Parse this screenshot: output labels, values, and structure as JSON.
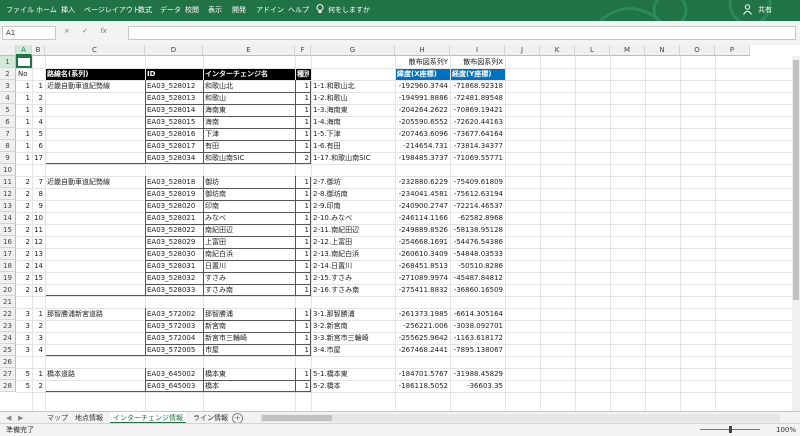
{
  "ribbon": {
    "tabs": [
      "ファイル",
      "ホーム",
      "挿入",
      "ページレイアウト",
      "数式",
      "データ",
      "校閲",
      "表示",
      "開発",
      "アドイン",
      "ヘルプ"
    ],
    "tell_me": "何をしますか",
    "share": "共有"
  },
  "formula_bar": {
    "name_box": "A1",
    "cancel": "×",
    "enter": "✓",
    "fx": "fx",
    "formula": ""
  },
  "columns": [
    "A",
    "B",
    "C",
    "D",
    "E",
    "F",
    "G",
    "H",
    "I",
    "J",
    "K",
    "L",
    "M",
    "N",
    "O",
    "P"
  ],
  "rows": [
    "1",
    "2",
    "3",
    "4",
    "5",
    "6",
    "7",
    "8",
    "9",
    "10",
    "11",
    "12",
    "13",
    "14",
    "15",
    "16",
    "17",
    "18",
    "19",
    "20",
    "21",
    "22",
    "23",
    "24",
    "25",
    "26",
    "27",
    "28"
  ],
  "table": {
    "series_y": "散布図系列Y",
    "series_x": "散布図系列X",
    "header": {
      "no": "No",
      "route": "路線名(系列)",
      "id": "ID",
      "ic": "インターチェンジ名",
      "kind": "種別",
      "lat": "緯度(X座標)",
      "lon": "経度(Y座標)"
    },
    "groups": [
      {
        "group_no": "1",
        "route": "近畿自動車道紀勢線",
        "rows": [
          [
            "1",
            "1",
            "EA03_528012",
            "和歌山北",
            "1",
            "1-1.和歌山北",
            "-192960.3744",
            "-71868.92318"
          ],
          [
            "1",
            "2",
            "EA03_528013",
            "和歌山",
            "1",
            "1-2.和歌山",
            "-194991.8886",
            "-72481.89548"
          ],
          [
            "1",
            "3",
            "EA03_528014",
            "海南東",
            "1",
            "1-3.海南東",
            "-204264.2622",
            "-70869.19421"
          ],
          [
            "1",
            "4",
            "EA03_528015",
            "海南",
            "1",
            "1-4.海南",
            "-205590.6552",
            "-72620.44163"
          ],
          [
            "1",
            "5",
            "EA03_528016",
            "下津",
            "1",
            "1-5.下津",
            "-207463.6096",
            "-73677.64164"
          ],
          [
            "1",
            "6",
            "EA03_528017",
            "有田",
            "1",
            "1-6.有田",
            "-214654.731",
            "-73814.34377"
          ],
          [
            "1",
            "17",
            "EA03_528034",
            "和歌山南SIC",
            "2",
            "1-17.和歌山南SIC",
            "-198485.3737",
            "-71069.55771"
          ]
        ]
      },
      {
        "group_no": "2",
        "route": "近畿自動車道紀勢線",
        "rows": [
          [
            "2",
            "7",
            "EA03_528018",
            "御坊",
            "1",
            "2-7.御坊",
            "-232880.6229",
            "-75409.61809"
          ],
          [
            "2",
            "8",
            "EA03_528019",
            "御坊南",
            "1",
            "2-8.御坊南",
            "-234041.4581",
            "-75612.63194"
          ],
          [
            "2",
            "9",
            "EA03_528020",
            "印南",
            "1",
            "2-9.印南",
            "-240900.2747",
            "-72214.46537"
          ],
          [
            "2",
            "10",
            "EA03_528021",
            "みなべ",
            "1",
            "2-10.みなべ",
            "-246114.1166",
            "-62582.8968"
          ],
          [
            "2",
            "11",
            "EA03_528022",
            "南紀田辺",
            "1",
            "2-11.南紀田辺",
            "-249889.8526",
            "-58138.95128"
          ],
          [
            "2",
            "12",
            "EA03_528029",
            "上富田",
            "1",
            "2-12.上富田",
            "-254668.1691",
            "-54476.54386"
          ],
          [
            "2",
            "13",
            "EA03_528030",
            "南紀白浜",
            "1",
            "2-13.南紀白浜",
            "-260610.3409",
            "-54848.03533"
          ],
          [
            "2",
            "14",
            "EA03_528031",
            "日置川",
            "1",
            "2-14.日置川",
            "-268451.8513",
            "-50510.8286"
          ],
          [
            "2",
            "15",
            "EA03_528032",
            "すさみ",
            "1",
            "2-15.すさみ",
            "-271089.9974",
            "-45487.84812"
          ],
          [
            "2",
            "16",
            "EA03_528033",
            "すさみ南",
            "1",
            "2-16.すさみ南",
            "-275411.8832",
            "-36860.16509"
          ]
        ]
      },
      {
        "group_no": "3",
        "route": "那智勝浦新宮道路",
        "rows": [
          [
            "3",
            "1",
            "EA03_572002",
            "那智勝浦",
            "1",
            "3-1.那智勝浦",
            "-261373.1985",
            "-6614.305164"
          ],
          [
            "3",
            "2",
            "EA03_572003",
            "新宮南",
            "1",
            "3-2.新宮南",
            "-256221.006",
            "-3038.092701"
          ],
          [
            "3",
            "3",
            "EA03_572004",
            "新宮市三輪崎",
            "1",
            "3-3.新宮市三輪崎",
            "-255625.9642",
            "-1163.618172"
          ],
          [
            "3",
            "4",
            "EA03_572005",
            "市屋",
            "1",
            "3-4.市屋",
            "-267468.2441",
            "-7895.138067"
          ]
        ]
      },
      {
        "group_no": "5",
        "route": "橋本道路",
        "rows": [
          [
            "5",
            "1",
            "EA03_645002",
            "橋本東",
            "1",
            "5-1.橋本東",
            "-184701.5767",
            "-31988.45829"
          ],
          [
            "5",
            "2",
            "EA03_645003",
            "橋本",
            "1",
            "5-2.橋本",
            "-186118.5052",
            "-36603.35"
          ]
        ]
      }
    ]
  },
  "sheet_tabs": [
    {
      "label": "マップ",
      "active": false
    },
    {
      "label": "地点情報",
      "active": false
    },
    {
      "label": "インターチェンジ情報",
      "active": true
    },
    {
      "label": "ライン情報",
      "active": false
    }
  ],
  "add_sheet": "+",
  "status": {
    "ready": "準備完了",
    "zoom": "100%"
  },
  "colors": {
    "excel_green": "#217346",
    "header_blue": "#0070c0",
    "header_black": "#000000"
  }
}
